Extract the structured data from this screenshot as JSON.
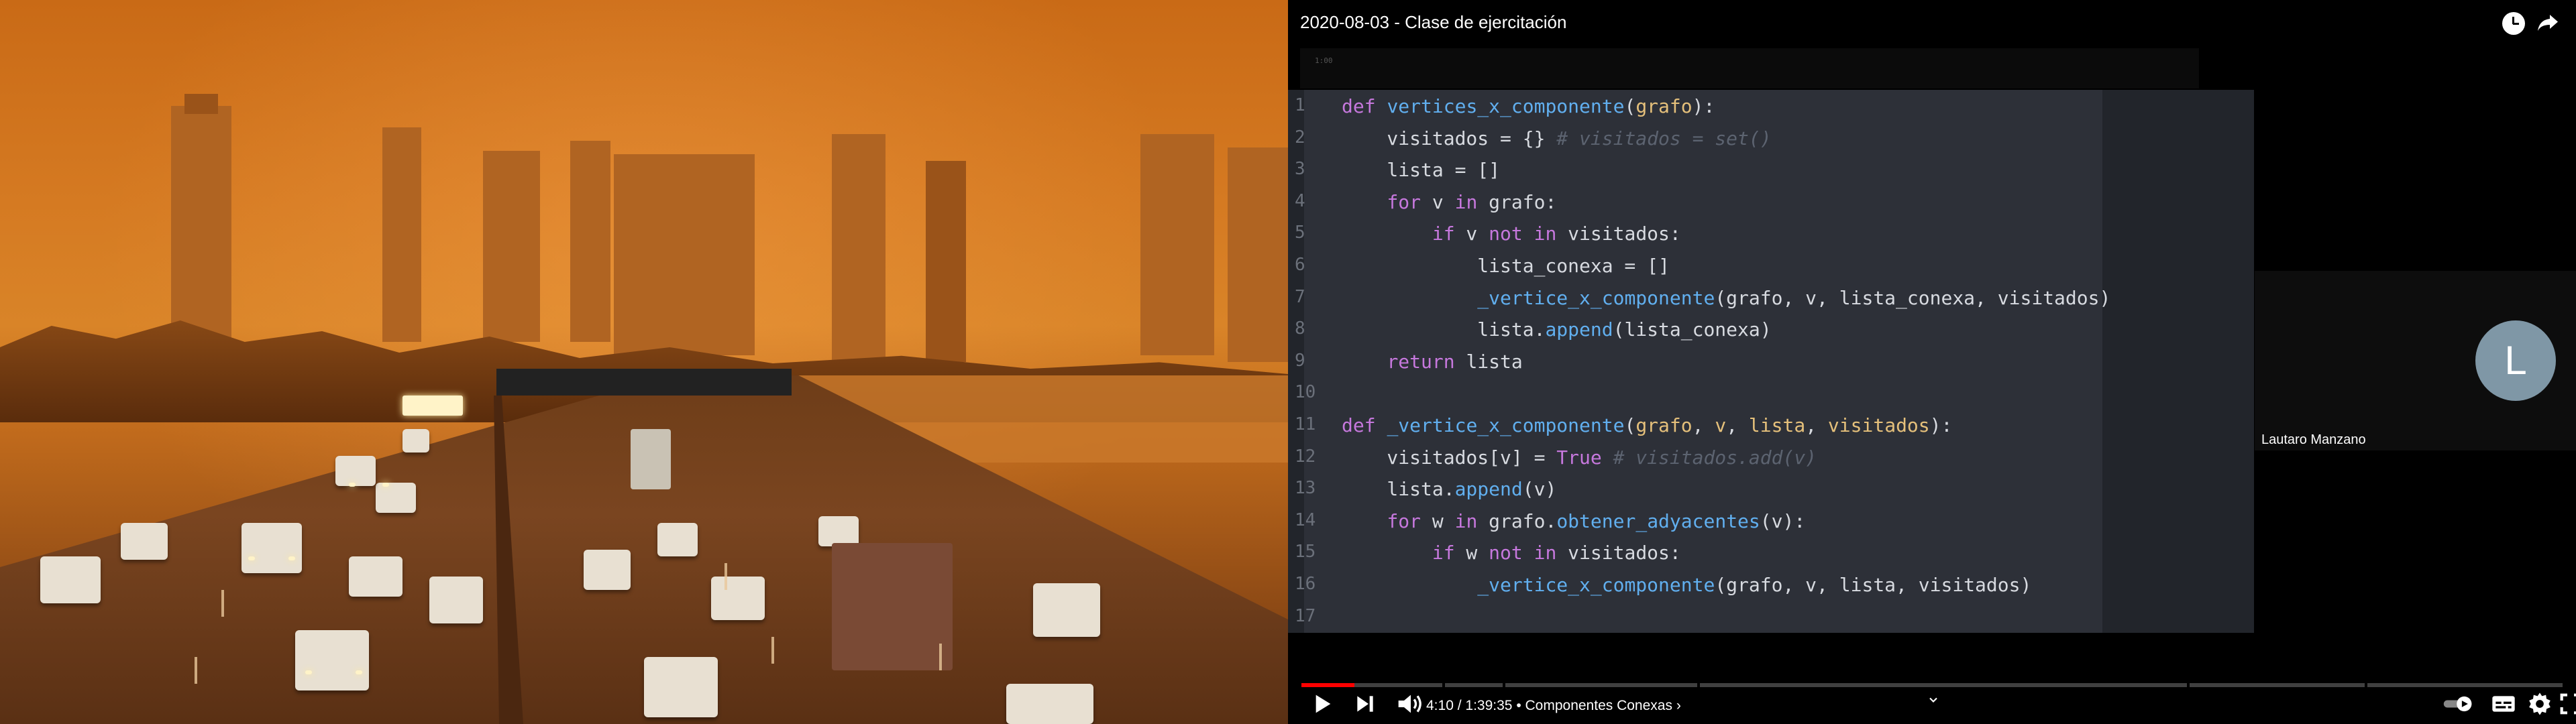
{
  "video": {
    "title": "2020-08-03 - Clase de ejercitación",
    "time_current": "4:10",
    "time_total": "1:39:35",
    "chapter": "Componentes Conexas",
    "progress": 0.042,
    "slide_counter": "1:00"
  },
  "participant": {
    "initial": "L",
    "name": "Lautaro Manzano"
  },
  "code": {
    "language": "python",
    "lines": [
      {
        "n": "1",
        "t": "def vertices_x_componente(grafo):"
      },
      {
        "n": "2",
        "t": "    visitados = {} # visitados = set()"
      },
      {
        "n": "3",
        "t": "    lista = []"
      },
      {
        "n": "4",
        "t": "    for v in grafo:"
      },
      {
        "n": "5",
        "t": "        if v not in visitados:"
      },
      {
        "n": "6",
        "t": "            lista_conexa = []"
      },
      {
        "n": "7",
        "t": "            _vertice_x_componente(grafo, v, lista_conexa, visitados)"
      },
      {
        "n": "8",
        "t": "            lista.append(lista_conexa)"
      },
      {
        "n": "9",
        "t": "    return lista"
      },
      {
        "n": "10",
        "t": ""
      },
      {
        "n": "11",
        "t": "def _vertice_x_componente(grafo, v, lista, visitados):"
      },
      {
        "n": "12",
        "t": "    visitados[v] = True # visitados.add(v)"
      },
      {
        "n": "13",
        "t": "    lista.append(v)"
      },
      {
        "n": "14",
        "t": "    for w in grafo.obtener_adyacentes(v):"
      },
      {
        "n": "15",
        "t": "        if w not in visitados:"
      },
      {
        "n": "16",
        "t": "            _vertice_x_componente(grafo, v, lista, visitados)"
      },
      {
        "n": "17",
        "t": ""
      }
    ]
  },
  "icons": {
    "watch_later": "clock-icon",
    "share": "share-arrow-icon",
    "play": "play-icon",
    "next": "next-icon",
    "volume": "volume-icon",
    "autoplay": "autoplay-toggle-icon",
    "subtitles": "subtitles-icon",
    "settings": "gear-icon",
    "fullscreen": "fullscreen-icon"
  },
  "colors": {
    "progress_played": "#ff0000",
    "avatar_bg": "#7f97a6",
    "code_bg": "#2d3038",
    "keyword": "#c678dd",
    "function": "#61afef",
    "param": "#e5c07b",
    "comment": "#5c6370"
  }
}
